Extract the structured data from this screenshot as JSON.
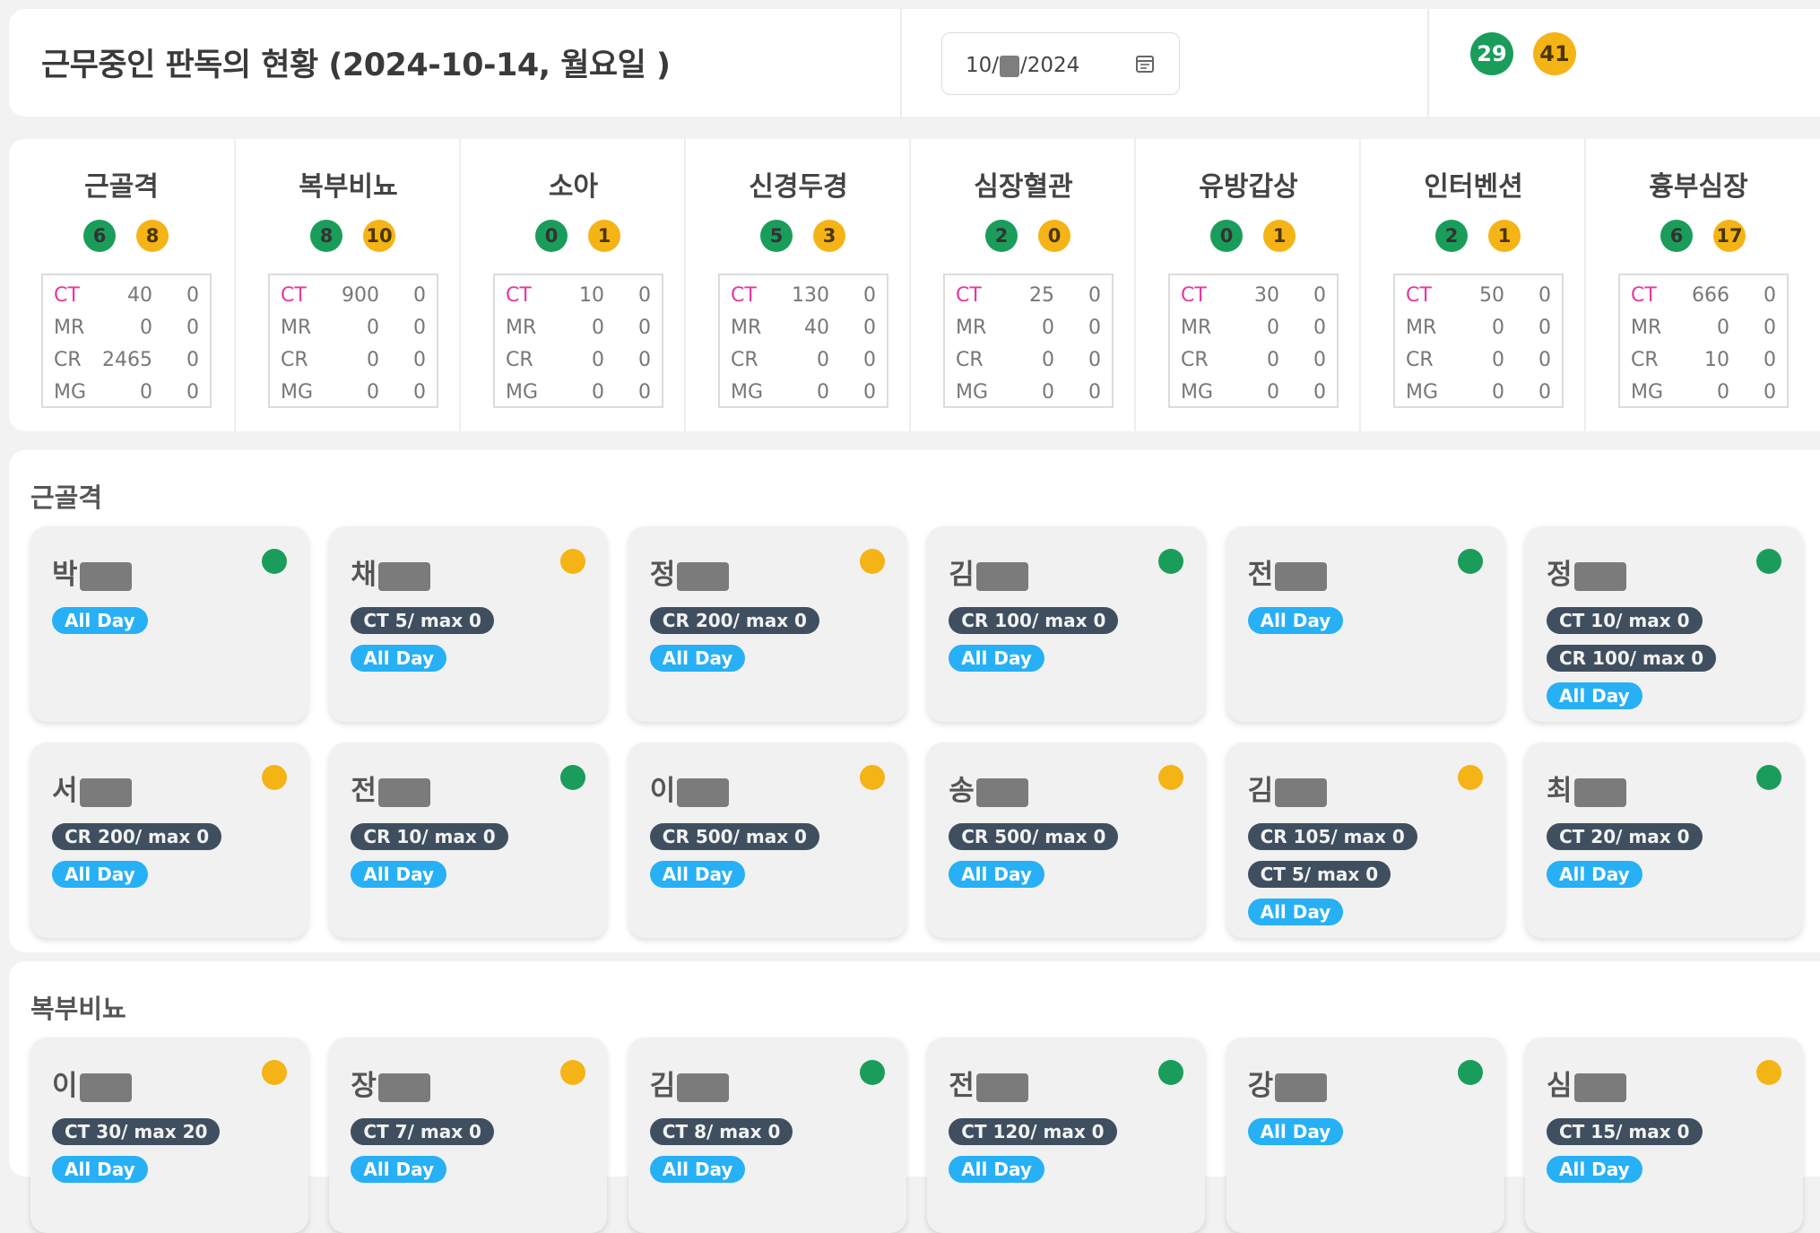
{
  "header": {
    "title": "근무중인 판독의 현황 (2024-10-14, 월요일 )",
    "date_prefix": "10/",
    "date_suffix": "/2024",
    "total_green": "29",
    "total_yellow": "41"
  },
  "summary": [
    {
      "name": "근골격",
      "green": "6",
      "yellow": "8",
      "rows": [
        [
          "CT",
          "40",
          "0"
        ],
        [
          "MR",
          "0",
          "0"
        ],
        [
          "CR",
          "2465",
          "0"
        ],
        [
          "MG",
          "0",
          "0"
        ]
      ]
    },
    {
      "name": "복부비뇨",
      "green": "8",
      "yellow": "10",
      "rows": [
        [
          "CT",
          "900",
          "0"
        ],
        [
          "MR",
          "0",
          "0"
        ],
        [
          "CR",
          "0",
          "0"
        ],
        [
          "MG",
          "0",
          "0"
        ]
      ]
    },
    {
      "name": "소아",
      "green": "0",
      "yellow": "1",
      "rows": [
        [
          "CT",
          "10",
          "0"
        ],
        [
          "MR",
          "0",
          "0"
        ],
        [
          "CR",
          "0",
          "0"
        ],
        [
          "MG",
          "0",
          "0"
        ]
      ]
    },
    {
      "name": "신경두경",
      "green": "5",
      "yellow": "3",
      "rows": [
        [
          "CT",
          "130",
          "0"
        ],
        [
          "MR",
          "40",
          "0"
        ],
        [
          "CR",
          "0",
          "0"
        ],
        [
          "MG",
          "0",
          "0"
        ]
      ]
    },
    {
      "name": "심장혈관",
      "green": "2",
      "yellow": "0",
      "rows": [
        [
          "CT",
          "25",
          "0"
        ],
        [
          "MR",
          "0",
          "0"
        ],
        [
          "CR",
          "0",
          "0"
        ],
        [
          "MG",
          "0",
          "0"
        ]
      ]
    },
    {
      "name": "유방갑상",
      "green": "0",
      "yellow": "1",
      "rows": [
        [
          "CT",
          "30",
          "0"
        ],
        [
          "MR",
          "0",
          "0"
        ],
        [
          "CR",
          "0",
          "0"
        ],
        [
          "MG",
          "0",
          "0"
        ]
      ]
    },
    {
      "name": "인터벤션",
      "green": "2",
      "yellow": "1",
      "rows": [
        [
          "CT",
          "50",
          "0"
        ],
        [
          "MR",
          "0",
          "0"
        ],
        [
          "CR",
          "0",
          "0"
        ],
        [
          "MG",
          "0",
          "0"
        ]
      ]
    },
    {
      "name": "흉부심장",
      "green": "6",
      "yellow": "17",
      "rows": [
        [
          "CT",
          "666",
          "0"
        ],
        [
          "MR",
          "0",
          "0"
        ],
        [
          "CR",
          "10",
          "0"
        ],
        [
          "MG",
          "0",
          "0"
        ]
      ]
    }
  ],
  "sections": [
    {
      "title": "근골격",
      "cards": [
        {
          "name": "박",
          "status": "green",
          "tags": [
            [
              "All Day",
              "blue"
            ]
          ]
        },
        {
          "name": "채",
          "status": "yellow",
          "tags": [
            [
              "CT 5/ max 0",
              "dark"
            ],
            [
              "All Day",
              "blue"
            ]
          ]
        },
        {
          "name": "정",
          "status": "yellow",
          "tags": [
            [
              "CR 200/ max 0",
              "dark"
            ],
            [
              "All Day",
              "blue"
            ]
          ]
        },
        {
          "name": "김",
          "status": "green",
          "tags": [
            [
              "CR 100/ max 0",
              "dark"
            ],
            [
              "All Day",
              "blue"
            ]
          ]
        },
        {
          "name": "전",
          "status": "green",
          "tags": [
            [
              "All Day",
              "blue"
            ]
          ]
        },
        {
          "name": "정",
          "status": "green",
          "tags": [
            [
              "CT 10/ max 0",
              "dark"
            ],
            [
              "CR 100/ max 0",
              "dark"
            ],
            [
              "All Day",
              "blue"
            ]
          ]
        },
        {
          "name": "서",
          "status": "yellow",
          "tags": [
            [
              "CR 200/ max 0",
              "dark"
            ],
            [
              "All Day",
              "blue"
            ]
          ]
        },
        {
          "name": "전",
          "status": "green",
          "tags": [
            [
              "CR 10/ max 0",
              "dark"
            ],
            [
              "All Day",
              "blue"
            ]
          ]
        },
        {
          "name": "이",
          "status": "yellow",
          "tags": [
            [
              "CR 500/ max 0",
              "dark"
            ],
            [
              "All Day",
              "blue"
            ]
          ]
        },
        {
          "name": "송",
          "status": "yellow",
          "tags": [
            [
              "CR 500/ max 0",
              "dark"
            ],
            [
              "All Day",
              "blue"
            ]
          ]
        },
        {
          "name": "김",
          "status": "yellow",
          "tags": [
            [
              "CR 105/ max 0",
              "dark"
            ],
            [
              "CT 5/ max 0",
              "dark"
            ],
            [
              "All Day",
              "blue"
            ]
          ]
        },
        {
          "name": "최",
          "status": "green",
          "tags": [
            [
              "CT 20/ max 0",
              "dark"
            ],
            [
              "All Day",
              "blue"
            ]
          ]
        }
      ]
    },
    {
      "title": "복부비뇨",
      "cards": [
        {
          "name": "이",
          "status": "yellow",
          "tags": [
            [
              "CT 30/ max 20",
              "dark"
            ],
            [
              "All Day",
              "blue"
            ]
          ]
        },
        {
          "name": "장",
          "status": "yellow",
          "tags": [
            [
              "CT 7/ max 0",
              "dark"
            ],
            [
              "All Day",
              "blue"
            ]
          ]
        },
        {
          "name": "김",
          "status": "green",
          "tags": [
            [
              "CT 8/ max 0",
              "dark"
            ],
            [
              "All Day",
              "blue"
            ]
          ]
        },
        {
          "name": "전",
          "status": "green",
          "tags": [
            [
              "CT 120/ max 0",
              "dark"
            ],
            [
              "All Day",
              "blue"
            ]
          ]
        },
        {
          "name": "강",
          "status": "green",
          "tags": [
            [
              "All Day",
              "blue"
            ]
          ]
        },
        {
          "name": "심",
          "status": "yellow",
          "tags": [
            [
              "CT 15/ max 0",
              "dark"
            ],
            [
              "All Day",
              "blue"
            ]
          ]
        }
      ]
    }
  ]
}
